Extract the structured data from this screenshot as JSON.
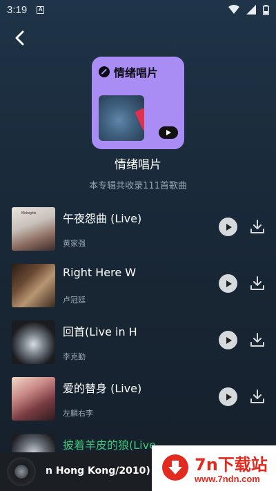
{
  "status_bar": {
    "time": "3:19",
    "notif_letter": "A"
  },
  "album": {
    "cover_title": "情绪唱片",
    "name": "情绪唱片",
    "subtitle": "本专辑共收录111首歌曲"
  },
  "songs": [
    {
      "title": "午夜怨曲 (Live)",
      "artist": "黄家强",
      "thumb_text": "Midnights"
    },
    {
      "title": "Right Here W",
      "artist": "卢冠廷"
    },
    {
      "title": "回首(Live in H",
      "artist": "李克勤"
    },
    {
      "title": "爱的替身 (Live)",
      "artist": "左麟右李"
    },
    {
      "title": "披着羊皮的狼(Live",
      "artist": ""
    }
  ],
  "now_playing": {
    "title": "n Hong Kong/2010)"
  },
  "watermark": {
    "name": "7n下载站",
    "url": "www.7ndn.com"
  },
  "colors": {
    "accent_green": "#3ec47a",
    "cover_purple": "#a98cf4",
    "watermark_red": "#e22a1e"
  }
}
